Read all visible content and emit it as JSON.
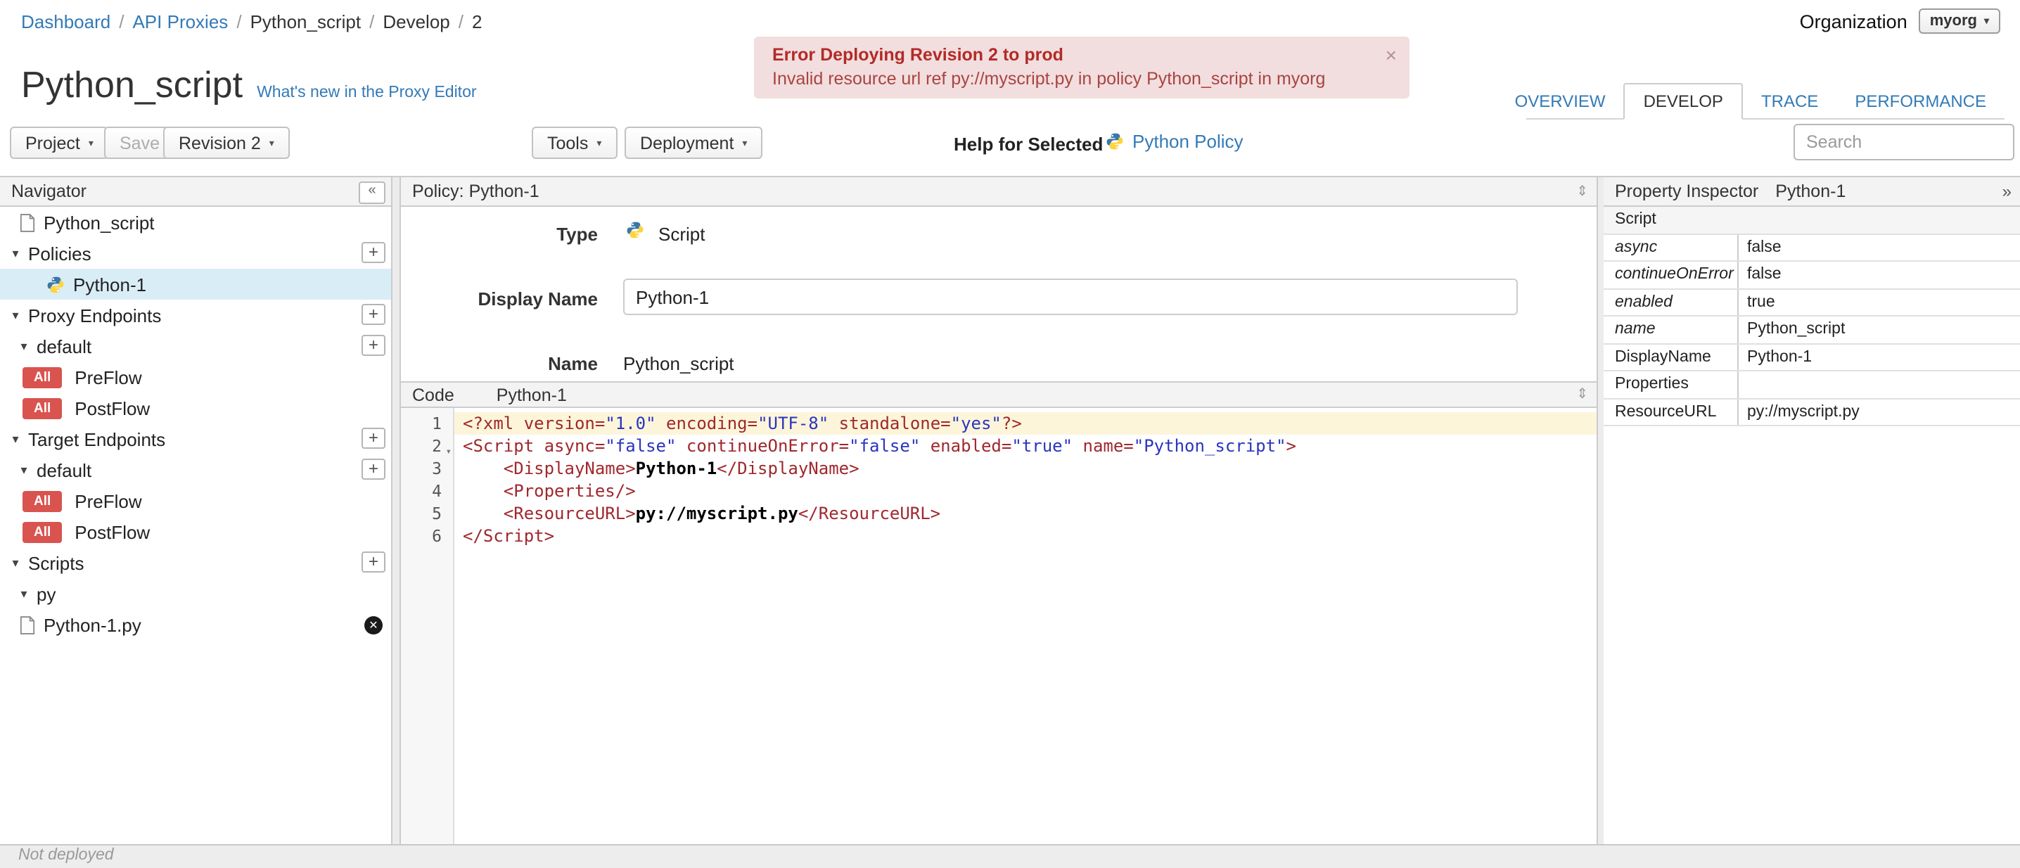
{
  "icons": {
    "caret_down": "▾",
    "dropdown_caret": "▾",
    "plus": "+",
    "close": "×",
    "delete_x": "✕",
    "collapse_left": "«",
    "expand_right": "»",
    "resize_vertical": "⇕"
  },
  "breadcrumb": {
    "separator": "/",
    "items": [
      {
        "label": "Dashboard",
        "link": true
      },
      {
        "label": "API Proxies",
        "link": true
      },
      {
        "label": "Python_script",
        "link": false
      },
      {
        "label": "Develop",
        "link": false
      },
      {
        "label": "2",
        "link": false
      }
    ]
  },
  "organization": {
    "label": "Organization",
    "value": "myorg"
  },
  "error_banner": {
    "title": "Error Deploying Revision 2 to prod",
    "message": "Invalid resource url ref py://myscript.py in policy Python_script in myorg"
  },
  "header": {
    "title": "Python_script",
    "whats_new": "What's new in the Proxy Editor"
  },
  "tabs": [
    {
      "label": "OVERVIEW",
      "active": false
    },
    {
      "label": "DEVELOP",
      "active": true
    },
    {
      "label": "TRACE",
      "active": false
    },
    {
      "label": "PERFORMANCE",
      "active": false
    }
  ],
  "toolbar": {
    "project": "Project",
    "save": "Save",
    "revision": "Revision 2",
    "tools": "Tools",
    "deployment": "Deployment",
    "help_for_selected": "Help for Selected",
    "policy_link": "Python Policy",
    "search_placeholder": "Search"
  },
  "navigator": {
    "title": "Navigator",
    "rows": [
      {
        "icon": "file",
        "label": "Python_script",
        "pad": 14
      },
      {
        "caret": true,
        "label": "Policies",
        "plus": true,
        "pad": 6
      },
      {
        "icon": "python",
        "label": "Python-1",
        "pad": 33,
        "selected": true
      },
      {
        "caret": true,
        "label": "Proxy Endpoints",
        "plus": true,
        "pad": 6
      },
      {
        "caret": true,
        "label": "default",
        "plus": true,
        "pad": 12
      },
      {
        "badge": "All",
        "label": "PreFlow",
        "pad": 16
      },
      {
        "badge": "All",
        "label": "PostFlow",
        "pad": 16
      },
      {
        "caret": true,
        "label": "Target Endpoints",
        "plus": true,
        "pad": 6
      },
      {
        "caret": true,
        "label": "default",
        "plus": true,
        "pad": 12
      },
      {
        "badge": "All",
        "label": "PreFlow",
        "pad": 16
      },
      {
        "badge": "All",
        "label": "PostFlow",
        "pad": 16
      },
      {
        "caret": true,
        "label": "Scripts",
        "plus": true,
        "pad": 6
      },
      {
        "caret": true,
        "label": "py",
        "pad": 12
      },
      {
        "icon": "file",
        "label": "Python-1.py",
        "pad": 14,
        "removable": true
      }
    ]
  },
  "policy_panel": {
    "title": "Policy: Python-1",
    "type_label": "Type",
    "type_value": "Script",
    "display_name_label": "Display Name",
    "display_name_value": "Python-1",
    "name_label": "Name",
    "name_value": "Python_script"
  },
  "code_panel": {
    "label": "Code",
    "file": "Python-1",
    "lines": [
      {
        "n": 1,
        "active": true,
        "seg": [
          [
            "t",
            "<?xml version="
          ],
          [
            "s",
            "\"1.0\""
          ],
          [
            "t",
            " encoding="
          ],
          [
            "s",
            "\"UTF-8\""
          ],
          [
            "t",
            " standalone="
          ],
          [
            "s",
            "\"yes\""
          ],
          [
            "t",
            "?>"
          ]
        ]
      },
      {
        "n": 2,
        "fold": true,
        "seg": [
          [
            "t",
            "<Script async="
          ],
          [
            "s",
            "\"false\""
          ],
          [
            "t",
            " continueOnError="
          ],
          [
            "s",
            "\"false\""
          ],
          [
            "t",
            " enabled="
          ],
          [
            "s",
            "\"true\""
          ],
          [
            "t",
            " name="
          ],
          [
            "s",
            "\"Python_script\""
          ],
          [
            "t",
            ">"
          ]
        ]
      },
      {
        "n": 3,
        "seg": [
          [
            "t",
            "    <DisplayName>"
          ],
          [
            "p",
            "Python-1"
          ],
          [
            "t",
            "</DisplayName>"
          ]
        ]
      },
      {
        "n": 4,
        "seg": [
          [
            "t",
            "    <Properties/>"
          ]
        ]
      },
      {
        "n": 5,
        "seg": [
          [
            "t",
            "    <ResourceURL>"
          ],
          [
            "p",
            "py://myscript.py"
          ],
          [
            "t",
            "</ResourceURL>"
          ]
        ]
      },
      {
        "n": 6,
        "seg": [
          [
            "t",
            "</Script>"
          ]
        ]
      }
    ]
  },
  "property_inspector": {
    "title": "Property Inspector",
    "subtitle": "Python-1",
    "section": "Script",
    "rows": [
      {
        "key": "async",
        "value": "false",
        "italic": true
      },
      {
        "key": "continueOnError",
        "value": "false",
        "italic": true
      },
      {
        "key": "enabled",
        "value": "true",
        "italic": true
      },
      {
        "key": "name",
        "value": "Python_script",
        "italic": true
      },
      {
        "key": "DisplayName",
        "value": "Python-1",
        "italic": false
      },
      {
        "key": "Properties",
        "value": "",
        "italic": false
      },
      {
        "key": "ResourceURL",
        "value": "py://myscript.py",
        "italic": false
      }
    ]
  },
  "status_bar": {
    "text": "Not deployed"
  }
}
